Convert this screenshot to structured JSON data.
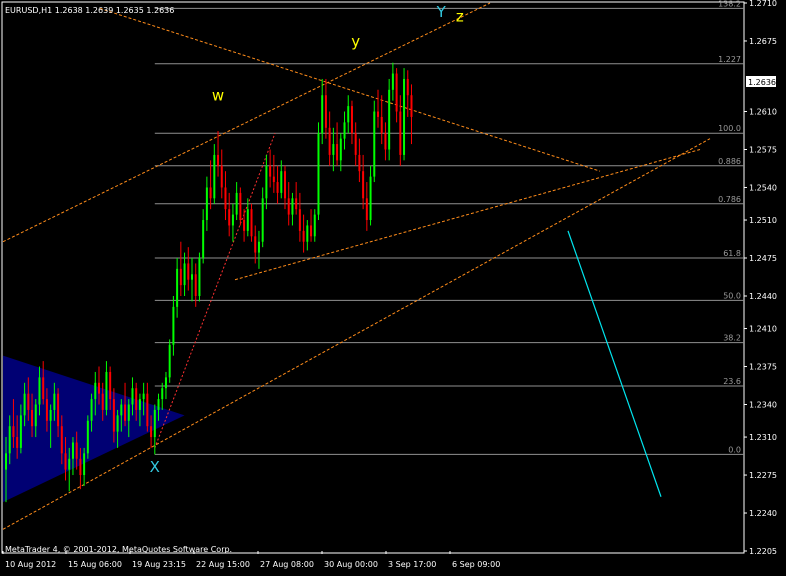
{
  "header": {
    "symbol_info": "EURUSD,H1  1.2638 1.2639 1.2635 1.2636",
    "copyright": "MetaTrader 4, © 2001-2012, MetaQuotes Software Corp."
  },
  "colors": {
    "background": "#000000",
    "frame": "#ffffff",
    "bull_candle": "#00ff00",
    "bear_candle": "#ff0000",
    "channel_lines": "#ff8c1a",
    "fib_lines": "#909090",
    "triangle_fill": "#000080",
    "projection_line": "#00e5ee",
    "wave_label": "#ffff00",
    "xy_label": "#33c9e0",
    "bid_box": "#ffffff"
  },
  "chart_data": {
    "type": "candlestick",
    "ylim": [
      1.2205,
      1.271
    ],
    "y_ticks": [
      "1.2710",
      "1.2675",
      "1.2610",
      "1.2575",
      "1.2540",
      "1.2510",
      "1.2475",
      "1.2440",
      "1.2410",
      "1.2375",
      "1.2340",
      "1.2310",
      "1.2275",
      "1.2240",
      "1.2205"
    ],
    "x_ticks": [
      "10 Aug 2012",
      "15 Aug 06:00",
      "19 Aug 23:15",
      "22 Aug 15:00",
      "27 Aug 08:00",
      "30 Aug 00:00",
      "3 Sep 17:00",
      "6 Sep 09:00"
    ],
    "current_price": "1.2636",
    "fib_levels": [
      {
        "label": "138.2",
        "price": 1.2705
      },
      {
        "label": "1.227",
        "price": 1.2654
      },
      {
        "label": "100.0",
        "price": 1.259
      },
      {
        "label": "0.886",
        "price": 1.256
      },
      {
        "label": "0.786",
        "price": 1.2525
      },
      {
        "label": "61.8",
        "price": 1.2475
      },
      {
        "label": "50.0",
        "price": 1.2436
      },
      {
        "label": "38.2",
        "price": 1.2397
      },
      {
        "label": "23.6",
        "price": 1.2357
      },
      {
        "label": "0.0",
        "price": 1.2294
      }
    ],
    "wave_labels": [
      {
        "text": "w",
        "bar": 57,
        "price": 1.262
      },
      {
        "text": "y",
        "bar": 94,
        "price": 1.267
      },
      {
        "text": "Y",
        "bar": 117,
        "price": 1.2697
      },
      {
        "text": "z",
        "bar": 122,
        "price": 1.2693
      },
      {
        "text": "X",
        "bar": 40,
        "price": 1.2278
      }
    ],
    "candles_ohlc": [
      [
        1.228,
        1.231,
        1.225,
        1.2295
      ],
      [
        1.2295,
        1.233,
        1.2285,
        1.232
      ],
      [
        1.232,
        1.2345,
        1.23,
        1.231
      ],
      [
        1.231,
        1.233,
        1.229,
        1.23
      ],
      [
        1.23,
        1.234,
        1.2295,
        1.233
      ],
      [
        1.233,
        1.236,
        1.232,
        1.235
      ],
      [
        1.235,
        1.2365,
        1.2325,
        1.2335
      ],
      [
        1.2335,
        1.235,
        1.231,
        1.232
      ],
      [
        1.232,
        1.2345,
        1.231,
        1.234
      ],
      [
        1.234,
        1.2375,
        1.233,
        1.2365
      ],
      [
        1.2365,
        1.238,
        1.234,
        1.2345
      ],
      [
        1.2345,
        1.2355,
        1.2315,
        1.2325
      ],
      [
        1.2325,
        1.234,
        1.23,
        1.2335
      ],
      [
        1.2335,
        1.236,
        1.2325,
        1.235
      ],
      [
        1.235,
        1.2355,
        1.231,
        1.232
      ],
      [
        1.232,
        1.233,
        1.2285,
        1.2295
      ],
      [
        1.2295,
        1.231,
        1.227,
        1.228
      ],
      [
        1.228,
        1.23,
        1.226,
        1.229
      ],
      [
        1.229,
        1.231,
        1.2275,
        1.2305
      ],
      [
        1.2305,
        1.2315,
        1.228,
        1.229
      ],
      [
        1.229,
        1.23,
        1.2262,
        1.2275
      ],
      [
        1.2275,
        1.23,
        1.2265,
        1.2295
      ],
      [
        1.2295,
        1.233,
        1.229,
        1.2325
      ],
      [
        1.2325,
        1.235,
        1.2315,
        1.2345
      ],
      [
        1.2345,
        1.237,
        1.233,
        1.236
      ],
      [
        1.236,
        1.2375,
        1.234,
        1.235
      ],
      [
        1.235,
        1.236,
        1.2325,
        1.2335
      ],
      [
        1.2335,
        1.238,
        1.233,
        1.237
      ],
      [
        1.237,
        1.2375,
        1.2335,
        1.2345
      ],
      [
        1.2345,
        1.2355,
        1.2305,
        1.2315
      ],
      [
        1.2315,
        1.2335,
        1.23,
        1.233
      ],
      [
        1.233,
        1.2345,
        1.2315,
        1.234
      ],
      [
        1.234,
        1.236,
        1.232,
        1.2325
      ],
      [
        1.2325,
        1.2345,
        1.231,
        1.234
      ],
      [
        1.234,
        1.2365,
        1.233,
        1.2355
      ],
      [
        1.2355,
        1.236,
        1.2325,
        1.2335
      ],
      [
        1.2335,
        1.235,
        1.232,
        1.2345
      ],
      [
        1.2345,
        1.236,
        1.233,
        1.235
      ],
      [
        1.235,
        1.236,
        1.2315,
        1.232
      ],
      [
        1.232,
        1.233,
        1.23,
        1.231
      ],
      [
        1.231,
        1.234,
        1.2294,
        1.2335
      ],
      [
        1.2335,
        1.235,
        1.2325,
        1.2345
      ],
      [
        1.2345,
        1.236,
        1.2335,
        1.2355
      ],
      [
        1.2355,
        1.237,
        1.2345,
        1.2365
      ],
      [
        1.2365,
        1.24,
        1.236,
        1.2395
      ],
      [
        1.2395,
        1.244,
        1.2385,
        1.243
      ],
      [
        1.243,
        1.2475,
        1.242,
        1.2465
      ],
      [
        1.2465,
        1.249,
        1.244,
        1.245
      ],
      [
        1.245,
        1.248,
        1.244,
        1.247
      ],
      [
        1.247,
        1.2485,
        1.2445,
        1.2455
      ],
      [
        1.2455,
        1.2475,
        1.2435,
        1.246
      ],
      [
        1.246,
        1.247,
        1.243,
        1.244
      ],
      [
        1.244,
        1.248,
        1.2435,
        1.2475
      ],
      [
        1.2475,
        1.252,
        1.247,
        1.251
      ],
      [
        1.251,
        1.255,
        1.25,
        1.254
      ],
      [
        1.254,
        1.2565,
        1.252,
        1.253
      ],
      [
        1.253,
        1.258,
        1.2525,
        1.257
      ],
      [
        1.257,
        1.2592,
        1.255,
        1.256
      ],
      [
        1.256,
        1.2575,
        1.253,
        1.254
      ],
      [
        1.254,
        1.2555,
        1.251,
        1.252
      ],
      [
        1.252,
        1.2535,
        1.2495,
        1.2505
      ],
      [
        1.2505,
        1.2525,
        1.249,
        1.2515
      ],
      [
        1.2515,
        1.2545,
        1.251,
        1.2535
      ],
      [
        1.2535,
        1.254,
        1.2505,
        1.251
      ],
      [
        1.251,
        1.252,
        1.249,
        1.25
      ],
      [
        1.25,
        1.253,
        1.2495,
        1.252
      ],
      [
        1.252,
        1.2525,
        1.249,
        1.2495
      ],
      [
        1.2495,
        1.2505,
        1.247,
        1.248
      ],
      [
        1.248,
        1.25,
        1.2465,
        1.249
      ],
      [
        1.249,
        1.254,
        1.2485,
        1.253
      ],
      [
        1.253,
        1.257,
        1.252,
        1.256
      ],
      [
        1.256,
        1.2575,
        1.254,
        1.255
      ],
      [
        1.255,
        1.257,
        1.2535,
        1.2545
      ],
      [
        1.2545,
        1.256,
        1.2525,
        1.2535
      ],
      [
        1.2535,
        1.2565,
        1.253,
        1.2555
      ],
      [
        1.2555,
        1.256,
        1.252,
        1.253
      ],
      [
        1.253,
        1.2545,
        1.2505,
        1.2515
      ],
      [
        1.2515,
        1.2535,
        1.2505,
        1.253
      ],
      [
        1.253,
        1.2545,
        1.2515,
        1.252
      ],
      [
        1.252,
        1.2535,
        1.249,
        1.25
      ],
      [
        1.25,
        1.2515,
        1.248,
        1.249
      ],
      [
        1.249,
        1.251,
        1.2482,
        1.2505
      ],
      [
        1.2505,
        1.252,
        1.249,
        1.2495
      ],
      [
        1.2495,
        1.252,
        1.249,
        1.2515
      ],
      [
        1.2515,
        1.26,
        1.251,
        1.259
      ],
      [
        1.259,
        1.264,
        1.258,
        1.2625
      ],
      [
        1.2625,
        1.264,
        1.2585,
        1.2595
      ],
      [
        1.2595,
        1.261,
        1.256,
        1.257
      ],
      [
        1.257,
        1.2595,
        1.2555,
        1.258
      ],
      [
        1.258,
        1.26,
        1.256,
        1.2565
      ],
      [
        1.2565,
        1.259,
        1.2555,
        1.2585
      ],
      [
        1.2585,
        1.261,
        1.2575,
        1.26
      ],
      [
        1.26,
        1.2625,
        1.259,
        1.2615
      ],
      [
        1.2615,
        1.262,
        1.258,
        1.259
      ],
      [
        1.259,
        1.26,
        1.256,
        1.257
      ],
      [
        1.257,
        1.2585,
        1.2545,
        1.2555
      ],
      [
        1.2555,
        1.257,
        1.252,
        1.253
      ],
      [
        1.253,
        1.2545,
        1.25,
        1.251
      ],
      [
        1.251,
        1.256,
        1.2505,
        1.255
      ],
      [
        1.255,
        1.262,
        1.2545,
        1.261
      ],
      [
        1.261,
        1.263,
        1.2595,
        1.2605
      ],
      [
        1.2605,
        1.2625,
        1.258,
        1.259
      ],
      [
        1.259,
        1.26,
        1.2565,
        1.2575
      ],
      [
        1.2575,
        1.264,
        1.2565,
        1.263
      ],
      [
        1.263,
        1.2655,
        1.262,
        1.2645
      ],
      [
        1.2645,
        1.265,
        1.26,
        1.261
      ],
      [
        1.261,
        1.2625,
        1.256,
        1.257
      ],
      [
        1.257,
        1.265,
        1.2565,
        1.264
      ],
      [
        1.264,
        1.2648,
        1.2605,
        1.2625
      ],
      [
        1.2625,
        1.2635,
        1.258,
        1.2605
      ]
    ]
  }
}
